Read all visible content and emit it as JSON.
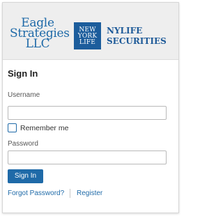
{
  "header": {
    "eagle_logo_lines": [
      "Eagle",
      "Strategies",
      "LLC"
    ],
    "nyl_logo_lines": [
      "NEW",
      "YORK",
      "LIFE"
    ],
    "nyl_securities_lines": [
      "NYLIFE",
      "SECURITIES"
    ]
  },
  "form": {
    "title": "Sign In",
    "username_label": "Username",
    "username_value": "",
    "remember_label": "Remember me",
    "remember_checked": false,
    "password_label": "Password",
    "password_value": "",
    "submit_label": "Sign In"
  },
  "links": {
    "forgot_password": "Forgot Password?",
    "register": "Register"
  },
  "colors": {
    "brand_blue": "#1f6aa8",
    "header_bg": "#eeeeee"
  }
}
